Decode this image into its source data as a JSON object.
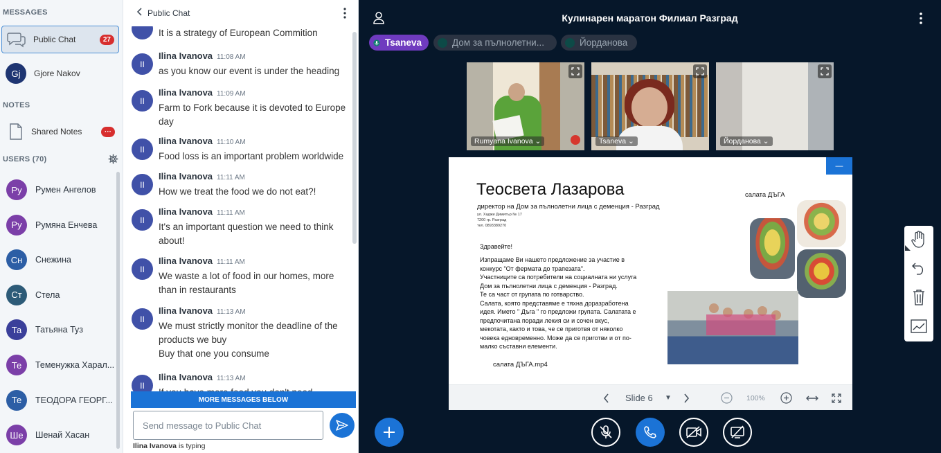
{
  "sidebar": {
    "messages_title": "MESSAGES",
    "public_chat": {
      "label": "Public Chat",
      "badge": "27"
    },
    "private_chat": {
      "initials": "Gj",
      "label": "Gjore Nakov"
    },
    "notes_title": "NOTES",
    "shared_notes": {
      "label": "Shared Notes",
      "badge": "···"
    },
    "users_title": "USERS (70)",
    "users": [
      {
        "initials": "Ру",
        "name": "Румен Ангелов",
        "color": "#7b3fa8",
        "status": "#0f7f70"
      },
      {
        "initials": "Ру",
        "name": "Румяна Енчева",
        "color": "#7b3fa8",
        "status": ""
      },
      {
        "initials": "Сн",
        "name": "Снежина",
        "color": "#2c5ea5",
        "status": "#0f7f70"
      },
      {
        "initials": "Ст",
        "name": "Стела",
        "color": "#2d5b78",
        "status": "#0f7f70"
      },
      {
        "initials": "Та",
        "name": "Татьяна Туз",
        "color": "#3a3f9a",
        "status": "#0f7f70"
      },
      {
        "initials": "Те",
        "name": "Теменужка Харал...",
        "color": "#7b3fa8",
        "status": "#d6372e"
      },
      {
        "initials": "Те",
        "name": "ТЕОДОРА ГЕОРГ...",
        "color": "#2c5ea5",
        "status": "#0f7f70"
      },
      {
        "initials": "Ше",
        "name": "Шенай Хасан",
        "color": "#7b3fa8",
        "status": "#d6372e"
      }
    ]
  },
  "chat": {
    "title": "Public Chat",
    "partial_top": "It is a strategy of European Commition",
    "messages": [
      {
        "initials": "II",
        "name": "Ilina Ivanova",
        "time": "11:08 AM",
        "text": "as you know our event is under the heading"
      },
      {
        "initials": "II",
        "name": "Ilina Ivanova",
        "time": "11:09 AM",
        "text": "Farm to Fork because it is devoted to Europe day"
      },
      {
        "initials": "II",
        "name": "Ilina Ivanova",
        "time": "11:10 AM",
        "text": "Food loss is an important problem worldwide"
      },
      {
        "initials": "II",
        "name": "Ilina Ivanova",
        "time": "11:11 AM",
        "text": "How we treat the food we do not eat?!"
      },
      {
        "initials": "II",
        "name": "Ilina Ivanova",
        "time": "11:11 AM",
        "text": "It's an important question we need to think about!"
      },
      {
        "initials": "II",
        "name": "Ilina Ivanova",
        "time": "11:11 AM",
        "text": "We waste a lot of food in our homes, more than in restaurants"
      },
      {
        "initials": "II",
        "name": "Ilina Ivanova",
        "time": "11:13 AM",
        "text": "We must strictly monitor the deadline of the products we buy"
      },
      {
        "initials": "II",
        "name": "Ilina Ivanova",
        "time": "11:13 AM",
        "text": "If you have more food you don't need"
      }
    ],
    "extra_line": "Buy that one you consume",
    "more_below": "MORE MESSAGES BELOW",
    "input_placeholder": "Send message to Public Chat",
    "typing_user": "Ilina Ivanova",
    "typing_suffix": " is typing"
  },
  "meeting": {
    "title": "Кулинарен маратон Филиал Разград",
    "talkers": [
      {
        "name": "Tsaneva",
        "active": true
      },
      {
        "name": "Дом за пълнолетни...",
        "active": false
      },
      {
        "name": "Йорданова",
        "active": false
      }
    ],
    "videos": [
      {
        "name": "Rumyana Ivanova"
      },
      {
        "name": "Tsaneva"
      },
      {
        "name": "Йорданова"
      }
    ]
  },
  "slide": {
    "name": "Теосвета Лазарова",
    "subtitle": "директор на Дом за пълнолетни лица с деменция - Разград",
    "addr1": "ул. Хаджи Димитър № 17",
    "addr2": "7200 гр. Разград",
    "addr3": "тел. 0893389270",
    "salad_label": "салата ДЪГА",
    "greeting": "Здравейте!",
    "body": [
      "Изпращаме Ви нашето предложение за участие в",
      "конкурс \"От фермата до трапезата\".",
      "Участниците са потребители на социалната ни услуга",
      "Дом за пълнолетни лица с деменция - Разград.",
      "Те са част от групата по готварство.",
      "Салата, която представяме е тяхна доразработена",
      "идея. Името \" Дъга \" го предложи групата. Салатата е",
      "предпочитана  поради лекия си и сочен вкус,",
      "мекотата, както и това, че се приготвя от няколко",
      "човека едновременно. Може да се приготви  и от по-",
      "малко съставни елементи."
    ],
    "file": "салата ДЪГА.mp4",
    "slide_label": "Slide 6",
    "zoom": "100%",
    "minimize": "—"
  }
}
